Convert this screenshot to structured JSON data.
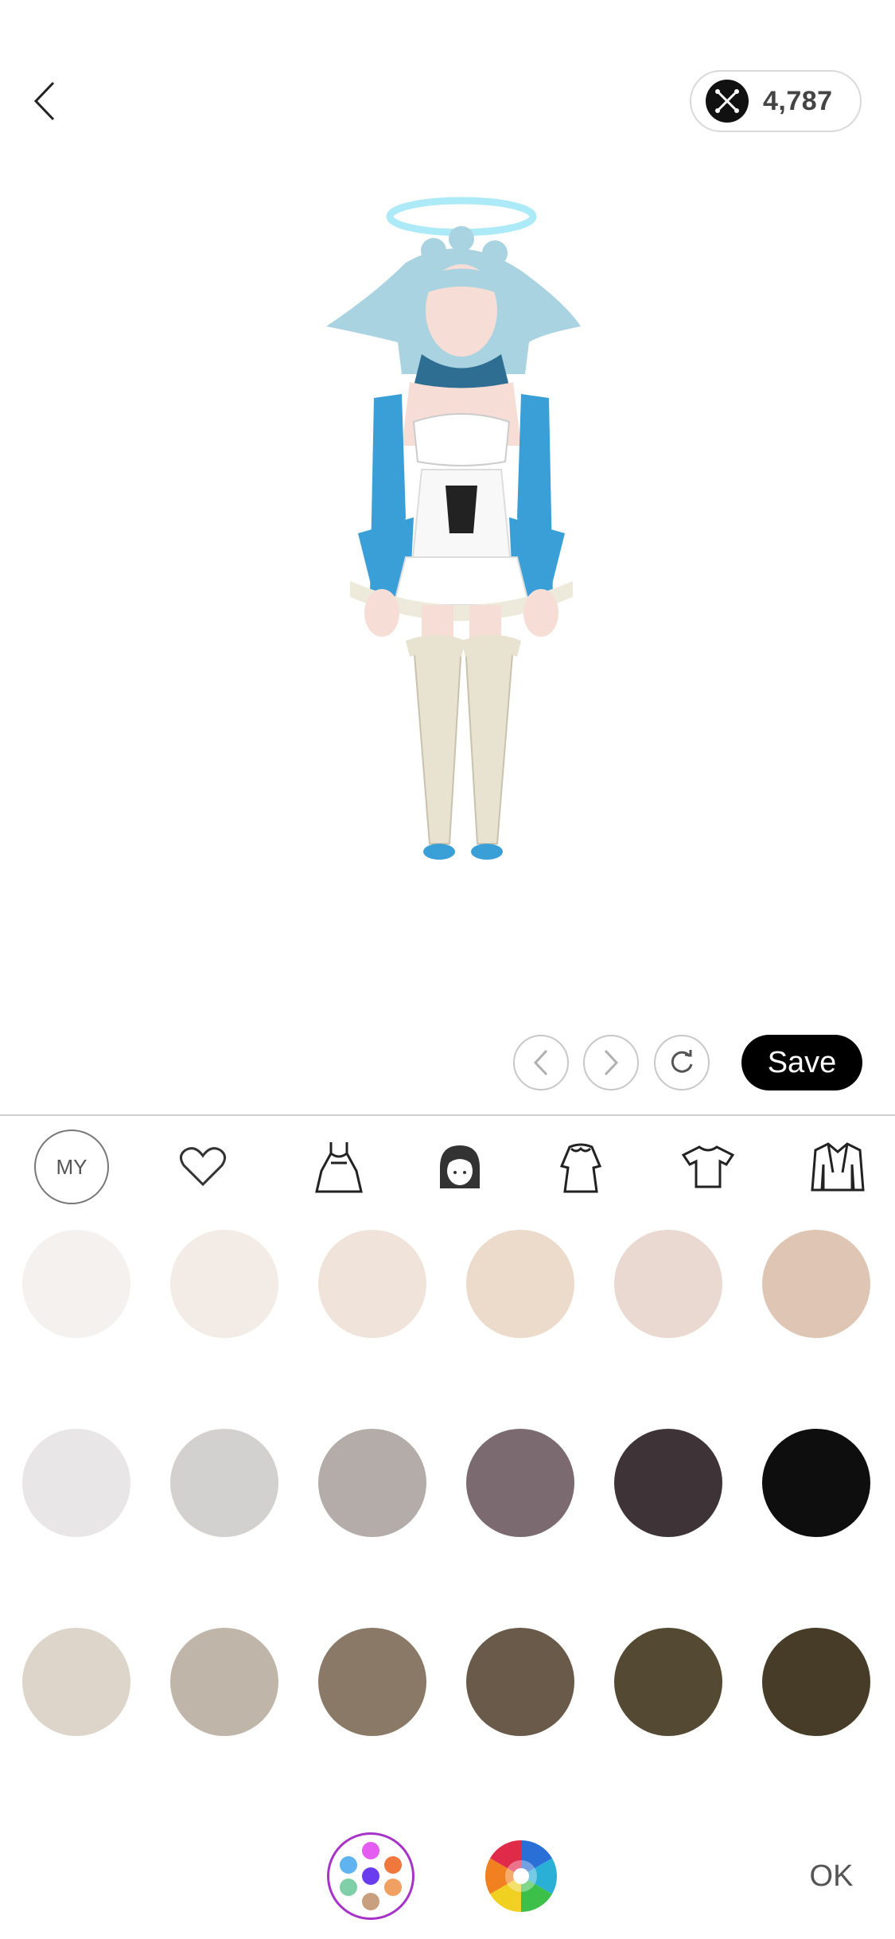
{
  "header": {
    "coin_balance": "4,787"
  },
  "toolbar": {
    "save_label": "Save"
  },
  "tabs": {
    "my_label": "MY",
    "items": [
      {
        "name": "my",
        "icon": "my-text"
      },
      {
        "name": "favorites",
        "icon": "heart-icon"
      },
      {
        "name": "dress",
        "icon": "dress-icon"
      },
      {
        "name": "hair",
        "icon": "hair-icon"
      },
      {
        "name": "outfit",
        "icon": "ruffle-dress-icon"
      },
      {
        "name": "tops",
        "icon": "tshirt-icon"
      },
      {
        "name": "outerwear",
        "icon": "jacket-icon"
      }
    ]
  },
  "swatches": [
    [
      "#f4f1ef",
      "#f2ebe6",
      "#efe3da",
      "#ecdacb",
      "#e9d9d0",
      "#dfc6b4"
    ],
    [
      "#e8e6e6",
      "#d3d0d0",
      "#b3aca9",
      "#7b6b70",
      "#3e3336",
      "#0e0e0e"
    ],
    [
      "#ded5ca",
      "#c0b5a9",
      "#8b7968",
      "#6a5a49",
      "#544a33",
      "#463c27"
    ]
  ],
  "bottom_bar": {
    "ok_label": "OK",
    "palette_colors": [
      "#e45cf0",
      "#f0783c",
      "#5fb4f0",
      "#6a3cf0",
      "#f0a060",
      "#7fd0a8",
      "#c8a080"
    ]
  },
  "avatar": {
    "hair_color": "#a9d3e0",
    "accent_color": "#3a9fd6"
  }
}
